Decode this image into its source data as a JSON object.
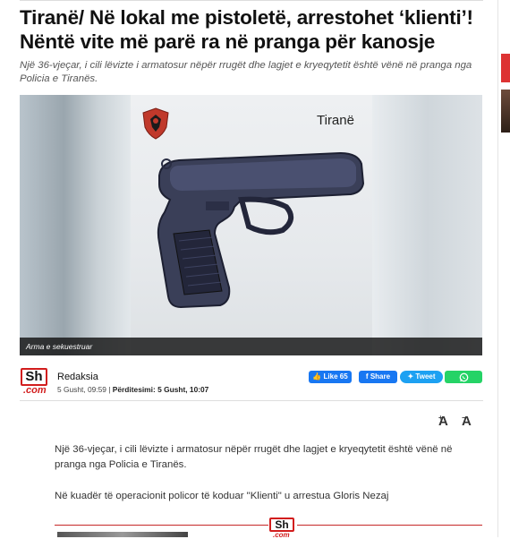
{
  "article": {
    "title": "Tiranë/ Në lokal me pistoletë, arrestohet ‘klienti’! Nëntë vite më parë ra në pranga për kanosje",
    "lead": "Një 36-vjeçar, i cili lëvizte i armatosur nëpër rrugët dhe lagjet e kryeqytetit është vënë në pranga nga Policia e Tiranës.",
    "image": {
      "overlay_city": "Tiranë",
      "caption": "Arma e sekuestruar"
    },
    "author": "Redaksia",
    "published": "5 Gusht, 09:59",
    "updated_label": "Përditesimi:",
    "updated": "5 Gusht, 10:07",
    "paragraphs": [
      "Një 36-vjeçar, i cili lëvizte i armatosur nëpër rrugët dhe lagjet e kryeqytetit është vënë në pranga nga Policia e Tiranës.",
      "Në kuadër të operacionit policor të koduar \"Klienti\" u arrestua Gloris Nezaj"
    ]
  },
  "brand": {
    "logo_top": "Sh",
    "logo_bottom": ".com",
    "accent": "#d21d1d"
  },
  "share": {
    "fb_like": "Like 65",
    "fb_share": "Share",
    "tweet": "Tweet",
    "whatsapp_icon": "whatsapp-icon"
  },
  "font_tools": {
    "increase": "A",
    "decrease": "A"
  }
}
